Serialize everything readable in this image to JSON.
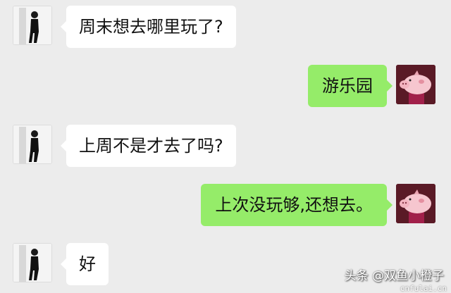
{
  "messages": [
    {
      "side": "left",
      "text": "周末想去哪里玩了?"
    },
    {
      "side": "right",
      "text": "游乐园"
    },
    {
      "side": "left",
      "text": "上周不是才去了吗?"
    },
    {
      "side": "right",
      "text": "上次没玩够,还想去。"
    },
    {
      "side": "left",
      "text": "好"
    }
  ],
  "watermark": {
    "main": "头条 @双鱼小橙子",
    "sub": "cnfulai.cn"
  },
  "colors": {
    "background": "#ececec",
    "sent_bubble": "#95ec69",
    "received_bubble": "#ffffff"
  }
}
